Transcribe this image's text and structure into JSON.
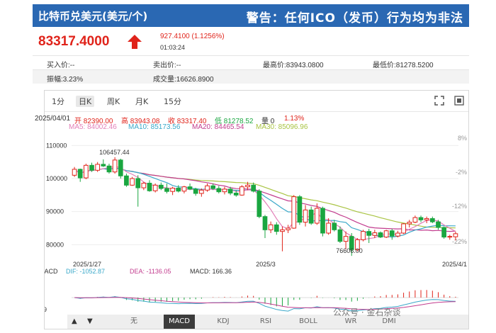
{
  "header": {
    "title": "比特币兑美元(美元/个)",
    "warning": "警告：任何ICO（发币）行为均为非法"
  },
  "quote": {
    "price": "83317.4000",
    "change": "927.4100 (1.1256%)",
    "time": "01:03:24"
  },
  "info": {
    "rows": [
      [
        {
          "label": "买入价:--"
        },
        {
          "label": "卖出价:--"
        },
        {
          "label": "最高价:83943.0800"
        },
        {
          "label": "最低价:81278.5200"
        }
      ],
      [
        {
          "label": "振幅:3.23%"
        },
        {
          "label": "成交量:16626.8900"
        }
      ]
    ]
  },
  "tabs": [
    "1分",
    "日K",
    "周K",
    "月K",
    "15分"
  ],
  "active_tab": "日K",
  "summary": {
    "date": "2025/04/01",
    "open": "开 82390.00",
    "high": "高 83943.08",
    "close": "收 83317.40",
    "low": "低 81278.52",
    "zero": "量 0",
    "pct": "1.13%",
    "ma5": "MA5: 84002.46",
    "ma10": "MA10: 85173.56",
    "ma20": "MA20: 84465.54",
    "ma30": "MA30: 85096.96"
  },
  "colors": {
    "header_bg": "#2a68b3",
    "up": "#e0241b",
    "down": "#1aa640",
    "ma5": "#e37fb7",
    "ma10": "#3aa8c9",
    "ma20": "#c23c8e",
    "ma30": "#a9c443"
  },
  "macd": {
    "label": "MACD",
    "dif": "DIF: -1052.87",
    "dea": "DEA: -1136.05",
    "macd": "MACD: 166.36",
    "y_top": "3519",
    "y_bottom": "-3519"
  },
  "indicators": [
    "无",
    "MACD",
    "KDJ",
    "RSI",
    "BOLL",
    "WR",
    "DMI"
  ],
  "active_indicator": "MACD",
  "watermark": "公众号 · 金石杂谈",
  "chart_data": {
    "type": "candlestick",
    "title": "",
    "y_ticks": [
      "110000",
      "100000",
      "90000",
      "80000"
    ],
    "y_right_ticks": [
      "8%",
      "-2%",
      "-12%",
      "-22%"
    ],
    "x_ticks": [
      "2025/1/27",
      "2025/3",
      "2025/4/1"
    ],
    "ylim": [
      76000,
      112000
    ],
    "grid": true,
    "annotations": [
      {
        "text": "106457.44",
        "x_index": 7,
        "y": 106457
      },
      {
        "text": "76606.00",
        "x_index": 48,
        "y": 76606
      }
    ],
    "candles": [
      [
        101000,
        103500,
        100500,
        102800
      ],
      [
        102800,
        103000,
        99000,
        100200
      ],
      [
        100200,
        104500,
        99800,
        104000
      ],
      [
        104000,
        104800,
        102000,
        102500
      ],
      [
        102500,
        105000,
        102000,
        104300
      ],
      [
        104300,
        105800,
        103500,
        103800
      ],
      [
        103800,
        104500,
        101500,
        102000
      ],
      [
        102000,
        106457,
        101500,
        105600
      ],
      [
        105600,
        106000,
        100000,
        100800
      ],
      [
        100800,
        101500,
        97500,
        98000
      ],
      [
        98000,
        100500,
        97800,
        100000
      ],
      [
        100000,
        101000,
        91500,
        97200
      ],
      [
        97200,
        99000,
        96500,
        98600
      ],
      [
        98600,
        99500,
        96000,
        96300
      ],
      [
        96300,
        98500,
        95800,
        98000
      ],
      [
        98000,
        98800,
        96500,
        97000
      ],
      [
        97000,
        98500,
        95500,
        96100
      ],
      [
        96100,
        97500,
        95000,
        97100
      ],
      [
        97100,
        98000,
        95800,
        96200
      ],
      [
        96200,
        97800,
        95500,
        97500
      ],
      [
        97500,
        98500,
        96500,
        96800
      ],
      [
        96800,
        97200,
        94800,
        95500
      ],
      [
        95500,
        97000,
        94500,
        96500
      ],
      [
        96500,
        98500,
        96000,
        97800
      ],
      [
        97800,
        98500,
        96500,
        97000
      ],
      [
        97000,
        97800,
        95500,
        96000
      ],
      [
        96000,
        97500,
        95200,
        96800
      ],
      [
        96800,
        97500,
        95000,
        95600
      ],
      [
        95600,
        96500,
        94500,
        95000
      ],
      [
        95000,
        98000,
        94800,
        97500
      ],
      [
        97500,
        99000,
        96500,
        98000
      ],
      [
        98000,
        98800,
        95800,
        96200
      ],
      [
        96200,
        96800,
        88000,
        88500
      ],
      [
        88500,
        89000,
        82000,
        84500
      ],
      [
        84500,
        87000,
        83500,
        86000
      ],
      [
        86000,
        86800,
        83000,
        84000
      ],
      [
        84000,
        85500,
        78000,
        84500
      ],
      [
        84500,
        86000,
        83500,
        85000
      ],
      [
        85000,
        95000,
        84800,
        94500
      ],
      [
        94500,
        95000,
        86000,
        86800
      ],
      [
        86800,
        92000,
        85500,
        90500
      ],
      [
        90500,
        91500,
        86000,
        86500
      ],
      [
        86500,
        92500,
        86000,
        91000
      ],
      [
        91000,
        91500,
        82500,
        83500
      ],
      [
        83500,
        88000,
        83000,
        86500
      ],
      [
        86500,
        87500,
        84000,
        84500
      ],
      [
        84500,
        85500,
        80500,
        81000
      ],
      [
        81000,
        84000,
        78500,
        82500
      ],
      [
        82500,
        83500,
        76606,
        78500
      ],
      [
        78500,
        82000,
        78000,
        81500
      ],
      [
        81500,
        84500,
        81000,
        84000
      ],
      [
        84000,
        84800,
        80500,
        82800
      ],
      [
        82800,
        84500,
        82000,
        83600
      ],
      [
        83600,
        84000,
        82000,
        82300
      ],
      [
        82300,
        84500,
        82000,
        84200
      ],
      [
        84200,
        84800,
        81500,
        82600
      ],
      [
        82600,
        84200,
        82200,
        83500
      ],
      [
        83500,
        86500,
        83200,
        86300
      ],
      [
        86300,
        87500,
        85200,
        86800
      ],
      [
        86800,
        88800,
        86500,
        88200
      ],
      [
        88200,
        88800,
        86800,
        87500
      ],
      [
        87500,
        88500,
        86500,
        87900
      ],
      [
        87900,
        88500,
        86500,
        86900
      ],
      [
        86900,
        87500,
        84500,
        85200
      ],
      [
        85200,
        85500,
        81800,
        82300
      ],
      [
        82300,
        83000,
        81500,
        82500
      ],
      [
        82390,
        83943,
        81278,
        83317
      ]
    ]
  }
}
